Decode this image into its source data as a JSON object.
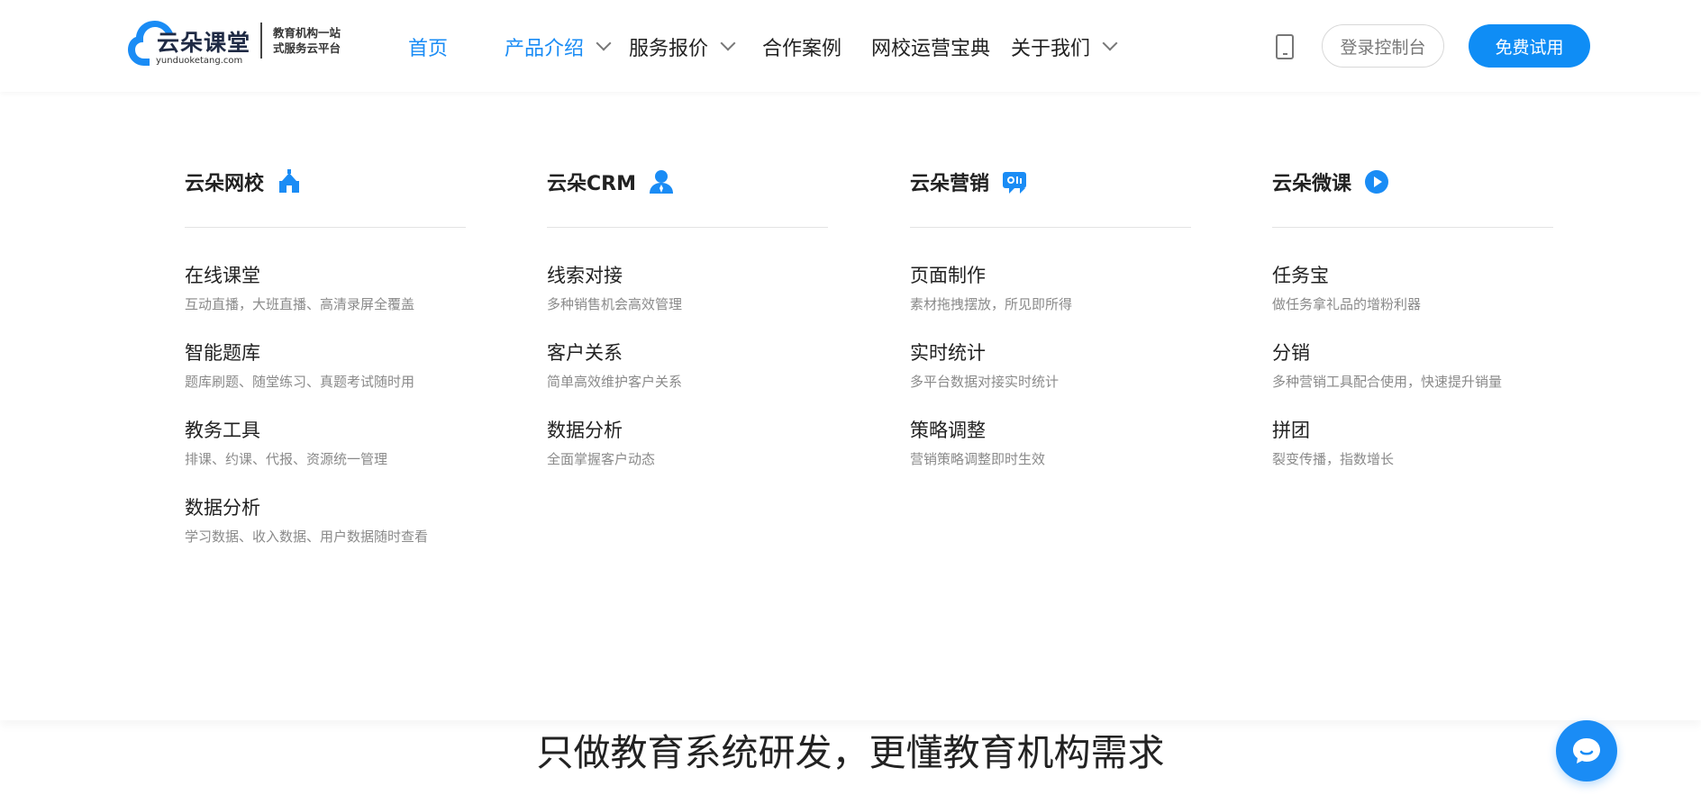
{
  "brand": {
    "name": "云朵课堂",
    "domain": "yunduoketang.com",
    "slogan_line1": "教育机构一站",
    "slogan_line2": "式服务云平台",
    "color": "#1a8cf5"
  },
  "nav": {
    "items": [
      {
        "label": "首页",
        "active": true
      },
      {
        "label": "产品介绍",
        "active": true,
        "dropdown": true
      },
      {
        "label": "服务报价",
        "dropdown": true
      },
      {
        "label": "合作案例"
      },
      {
        "label": "网校运营宝典"
      },
      {
        "label": "关于我们",
        "dropdown": true
      }
    ],
    "login_label": "登录控制台",
    "trial_label": "免费试用"
  },
  "menu": {
    "columns": [
      {
        "title": "云朵网校",
        "icon": "school-icon",
        "items": [
          {
            "title": "在线课堂",
            "desc": "互动直播，大班直播、高清录屏全覆盖"
          },
          {
            "title": "智能题库",
            "desc": "题库刷题、随堂练习、真题考试随时用"
          },
          {
            "title": "教务工具",
            "desc": "排课、约课、代报、资源统一管理"
          },
          {
            "title": "数据分析",
            "desc": "学习数据、收入数据、用户数据随时查看"
          }
        ]
      },
      {
        "title": "云朵CRM",
        "icon": "user-icon",
        "items": [
          {
            "title": "线索对接",
            "desc": "多种销售机会高效管理"
          },
          {
            "title": "客户关系",
            "desc": "简单高效维护客户关系"
          },
          {
            "title": "数据分析",
            "desc": "全面掌握客户动态"
          }
        ]
      },
      {
        "title": "云朵营销",
        "icon": "marketing-icon",
        "items": [
          {
            "title": "页面制作",
            "desc": "素材拖拽摆放，所见即所得"
          },
          {
            "title": "实时统计",
            "desc": "多平台数据对接实时统计"
          },
          {
            "title": "策略调整",
            "desc": "营销策略调整即时生效"
          }
        ]
      },
      {
        "title": "云朵微课",
        "icon": "play-icon",
        "items": [
          {
            "title": "任务宝",
            "desc": "做任务拿礼品的增粉利器"
          },
          {
            "title": "分销",
            "desc": "多种营销工具配合使用，快速提升销量"
          },
          {
            "title": "拼团",
            "desc": "裂变传播，指数增长"
          }
        ]
      }
    ]
  },
  "page": {
    "headline": "只做教育系统研发，更懂教育机构需求"
  }
}
